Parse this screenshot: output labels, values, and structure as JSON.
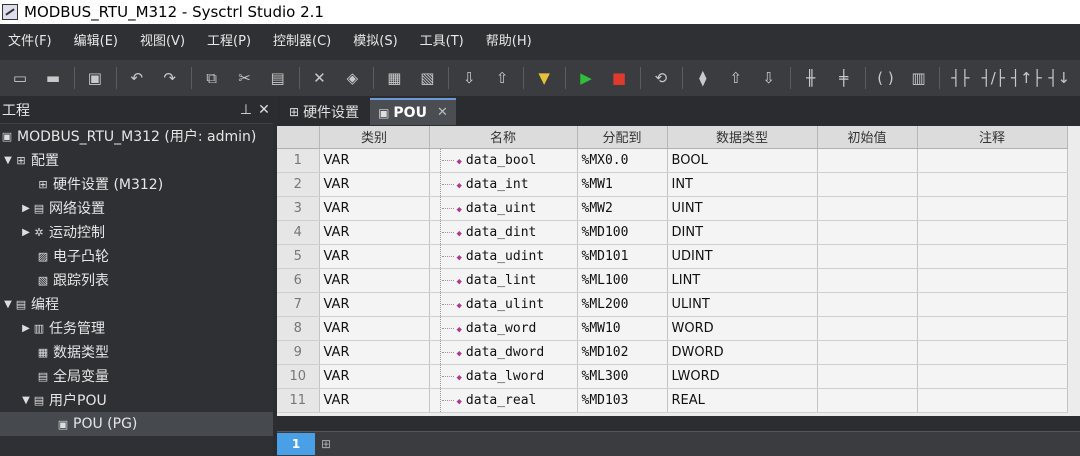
{
  "window": {
    "title": "MODBUS_RTU_M312 - Sysctrl Studio 2.1"
  },
  "menu": [
    "文件(F)",
    "编辑(E)",
    "视图(V)",
    "工程(P)",
    "控制器(C)",
    "模拟(S)",
    "工具(T)",
    "帮助(H)"
  ],
  "project_panel": {
    "title": "工程",
    "root": "MODBUS_RTU_M312 (用户: admin)",
    "config": "配置",
    "hardware": "硬件设置 (M312)",
    "network": "网络设置",
    "motion": "运动控制",
    "cam": "电子凸轮",
    "trace": "跟踪列表",
    "programming": "编程",
    "tasks": "任务管理",
    "datatypes": "数据类型",
    "globals": "全局变量",
    "user_pou": "用户POU",
    "pou": "POU (PG)"
  },
  "tabs": {
    "hardware": "硬件设置",
    "pou": "POU"
  },
  "table": {
    "headers": [
      "类别",
      "名称",
      "分配到",
      "数据类型",
      "初始值",
      "注释"
    ],
    "rows": [
      {
        "n": "1",
        "cat": "VAR",
        "name": "data_bool",
        "addr": "%MX0.0",
        "type": "BOOL"
      },
      {
        "n": "2",
        "cat": "VAR",
        "name": "data_int",
        "addr": "%MW1",
        "type": "INT"
      },
      {
        "n": "3",
        "cat": "VAR",
        "name": "data_uint",
        "addr": "%MW2",
        "type": "UINT"
      },
      {
        "n": "4",
        "cat": "VAR",
        "name": "data_dint",
        "addr": "%MD100",
        "type": "DINT"
      },
      {
        "n": "5",
        "cat": "VAR",
        "name": "data_udint",
        "addr": "%MD101",
        "type": "UDINT"
      },
      {
        "n": "6",
        "cat": "VAR",
        "name": "data_lint",
        "addr": "%ML100",
        "type": "LINT"
      },
      {
        "n": "7",
        "cat": "VAR",
        "name": "data_ulint",
        "addr": "%ML200",
        "type": "ULINT"
      },
      {
        "n": "8",
        "cat": "VAR",
        "name": "data_word",
        "addr": "%MW10",
        "type": "WORD"
      },
      {
        "n": "9",
        "cat": "VAR",
        "name": "data_dword",
        "addr": "%MD102",
        "type": "DWORD"
      },
      {
        "n": "10",
        "cat": "VAR",
        "name": "data_lword",
        "addr": "%ML300",
        "type": "LWORD"
      },
      {
        "n": "11",
        "cat": "VAR",
        "name": "data_real",
        "addr": "%MD103",
        "type": "REAL"
      }
    ]
  },
  "page_tabs": {
    "current": "1"
  }
}
